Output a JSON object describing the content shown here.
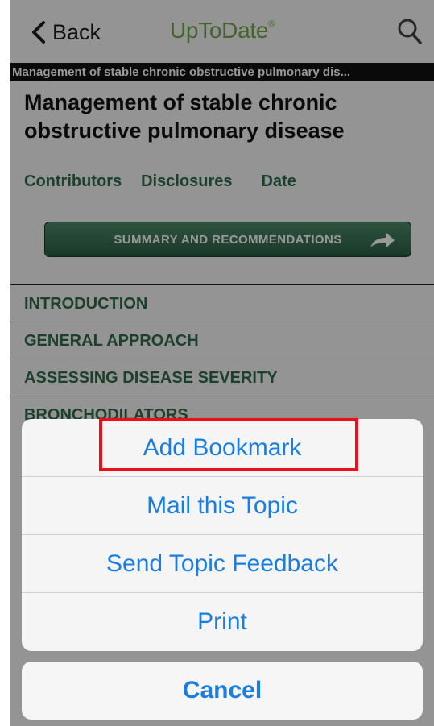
{
  "nav": {
    "back_label": "Back",
    "logo": "UpToDate",
    "logo_mark": "®"
  },
  "breadcrumb": "Management of stable chronic obstructive pulmonary dis...",
  "topic": {
    "title_line1": "Management of stable chronic",
    "title_line2": "obstructive pulmonary disease"
  },
  "links": [
    "Contributors",
    "Disclosures",
    "Date"
  ],
  "summary_button": "SUMMARY AND RECOMMENDATIONS",
  "toc": [
    "INTRODUCTION",
    "GENERAL APPROACH",
    "ASSESSING DISEASE SEVERITY",
    "BRONCHODILATORS"
  ],
  "action_sheet": {
    "items": [
      "Add Bookmark",
      "Mail this Topic",
      "Send Topic Feedback",
      "Print"
    ],
    "cancel": "Cancel"
  },
  "colors": {
    "logo_green": "#6ea64a",
    "link_green": "#2e6b4a",
    "action_blue": "#1a7de0",
    "highlight_red": "#e8101a"
  }
}
